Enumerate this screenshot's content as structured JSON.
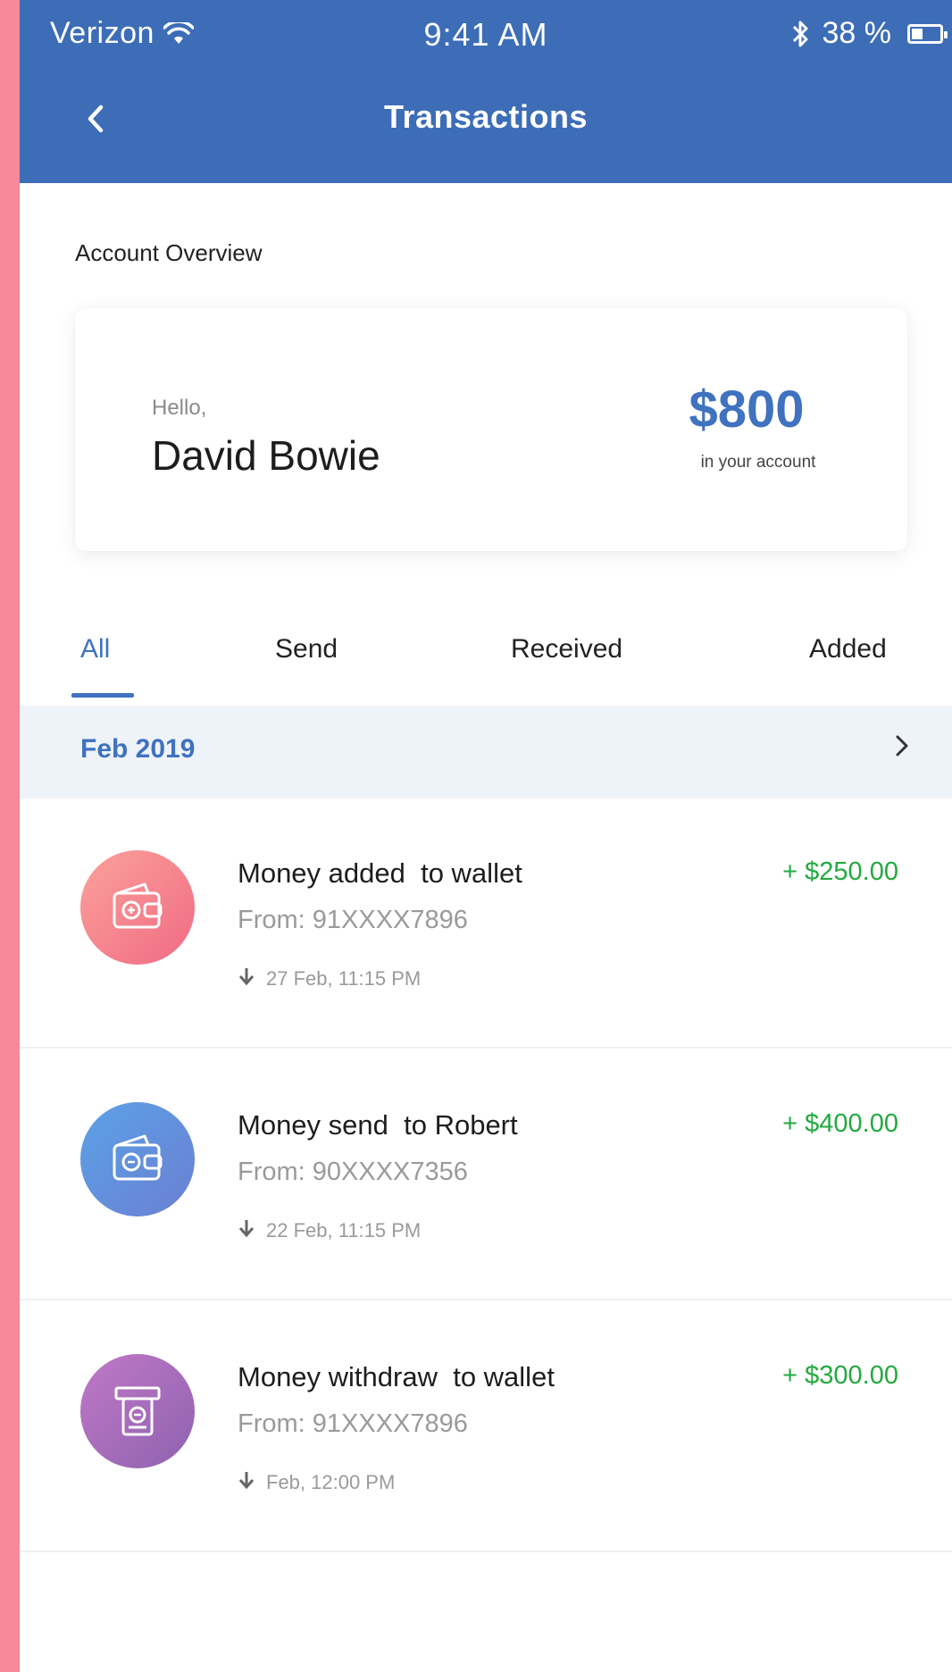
{
  "status_bar": {
    "carrier": "Verizon",
    "time": "9:41 AM",
    "battery": "38 %"
  },
  "header": {
    "title": "Transactions"
  },
  "overview": {
    "label": "Account Overview",
    "greeting": "Hello,",
    "name": "David Bowie",
    "balance": "$800",
    "balance_caption": "in your account"
  },
  "tabs": [
    {
      "label": "All",
      "active": true
    },
    {
      "label": "Send",
      "active": false
    },
    {
      "label": "Received",
      "active": false
    },
    {
      "label": "Added",
      "active": false
    }
  ],
  "month": {
    "label": "Feb 2019"
  },
  "transactions": [
    {
      "title": "Money added  to wallet",
      "from": "From: 91XXXX7896",
      "date": "27 Feb, 11:15 PM",
      "amount": "+ $250.00",
      "icon": "wallet-icon",
      "color": "#f47e88"
    },
    {
      "title": "Money send  to Robert",
      "from": "From: 90XXXX7356",
      "date": "22 Feb, 11:15 PM",
      "amount": "+ $400.00",
      "icon": "wallet-icon",
      "color": "#5e8fdb"
    },
    {
      "title": "Money withdraw  to wallet",
      "from": "From: 91XXXX7896",
      "date": "Feb, 12:00 PM",
      "amount": "+ $300.00",
      "icon": "atm-icon",
      "color": "#a46bb9"
    }
  ]
}
